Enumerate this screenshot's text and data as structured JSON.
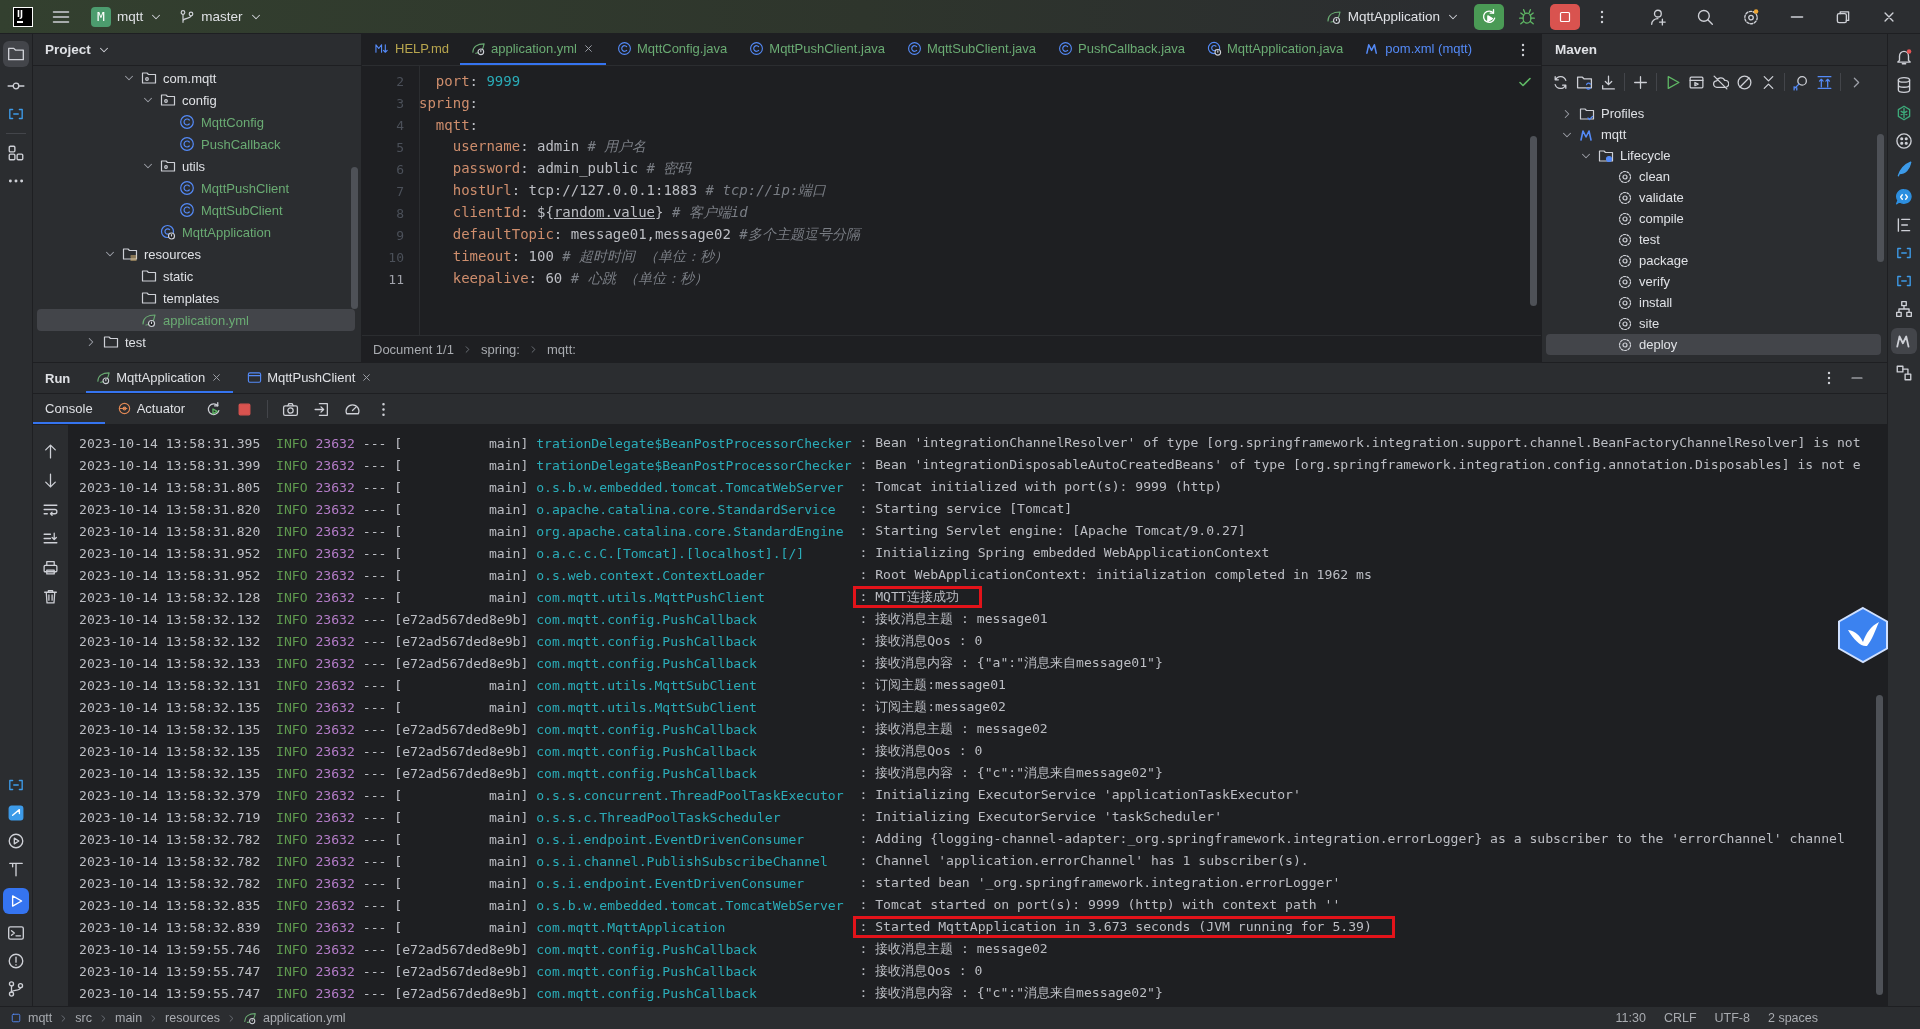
{
  "title_bar": {
    "logo": "IJ",
    "project_badge": "M",
    "project": "mqtt",
    "branch": "master",
    "run_config": "MqttApplication"
  },
  "project_panel": {
    "title": "Project",
    "tree": [
      {
        "children": [
          {
            "children": [
              {
                "label": "com.mqtt",
                "kind": "package",
                "expanded": true,
                "selected": false,
                "children": [
                  {
                    "label": "config",
                    "kind": "package",
                    "expanded": true,
                    "selected": false,
                    "children": [
                      {
                        "label": "MqttConfig",
                        "kind": "class",
                        "selected": false
                      },
                      {
                        "label": "PushCallback",
                        "kind": "class",
                        "selected": false
                      }
                    ]
                  },
                  {
                    "label": "utils",
                    "kind": "package",
                    "expanded": true,
                    "selected": false,
                    "children": [
                      {
                        "label": "MqttPushClient",
                        "kind": "class",
                        "selected": false
                      },
                      {
                        "label": "MqttSubClient",
                        "kind": "class",
                        "selected": false
                      }
                    ]
                  },
                  {
                    "label": "MqttApplication",
                    "kind": "app",
                    "selected": false
                  }
                ]
              }
            ]
          },
          {
            "label": "resources",
            "kind": "resources",
            "expanded": true,
            "selected": false,
            "children": [
              {
                "label": "static",
                "kind": "folder",
                "selected": false
              },
              {
                "label": "templates",
                "kind": "folder",
                "selected": false
              },
              {
                "label": "application.yml",
                "kind": "yaml",
                "selected": true
              }
            ]
          }
        ]
      },
      {
        "label": "test",
        "kind": "folder",
        "expanded": false,
        "selected": false
      }
    ]
  },
  "editor": {
    "tabs": [
      {
        "label": "HELP.md",
        "kind": "markdown",
        "color": "#b8a64e",
        "selected": false
      },
      {
        "label": "application.yml",
        "kind": "yaml",
        "color": "#6aab73",
        "selected": true
      },
      {
        "label": "MqttConfig.java",
        "kind": "class",
        "color": "#6aab73",
        "selected": false
      },
      {
        "label": "MqttPushClient.java",
        "kind": "class",
        "color": "#6aab73",
        "selected": false
      },
      {
        "label": "MqttSubClient.java",
        "kind": "class",
        "color": "#6aab73",
        "selected": false
      },
      {
        "label": "PushCallback.java",
        "kind": "class",
        "color": "#6aab73",
        "selected": false
      },
      {
        "label": "MqttApplication.java",
        "kind": "app",
        "color": "#6aab73",
        "selected": false
      },
      {
        "label": "pom.xml (mqtt)",
        "kind": "maven",
        "color": "#548af7",
        "selected": false
      }
    ],
    "lines": [
      {
        "number": "2",
        "current": false,
        "tokens": [
          {
            "kind": "key",
            "text": "  port"
          },
          {
            "kind": "plain",
            "text": ": "
          },
          {
            "kind": "number",
            "text": "9999"
          }
        ]
      },
      {
        "number": "3",
        "current": false,
        "tokens": [
          {
            "kind": "key",
            "text": "spring"
          },
          {
            "kind": "plain",
            "text": ":"
          }
        ]
      },
      {
        "number": "4",
        "current": false,
        "tokens": [
          {
            "kind": "key",
            "text": "  mqtt"
          },
          {
            "kind": "plain",
            "text": ":"
          }
        ]
      },
      {
        "number": "5",
        "current": false,
        "tokens": [
          {
            "kind": "key",
            "text": "    username"
          },
          {
            "kind": "plain",
            "text": ": admin "
          },
          {
            "kind": "comment",
            "text": "# 用户名"
          }
        ]
      },
      {
        "number": "6",
        "current": false,
        "tokens": [
          {
            "kind": "key",
            "text": "    password"
          },
          {
            "kind": "plain",
            "text": ": admin_public "
          },
          {
            "kind": "comment",
            "text": "# 密码"
          }
        ]
      },
      {
        "number": "7",
        "current": false,
        "tokens": [
          {
            "kind": "key",
            "text": "    hostUrl"
          },
          {
            "kind": "plain",
            "text": ": tcp://127.0.0.1:1883 "
          },
          {
            "kind": "comment",
            "text": "# tcp://ip:端口"
          }
        ]
      },
      {
        "number": "8",
        "current": false,
        "tokens": [
          {
            "kind": "key",
            "text": "    clientId"
          },
          {
            "kind": "plain",
            "text": ": ${"
          },
          {
            "kind": "ref",
            "text": "random.value"
          },
          {
            "kind": "plain",
            "text": "} "
          },
          {
            "kind": "comment",
            "text": "# 客户端id"
          }
        ]
      },
      {
        "number": "9",
        "current": false,
        "tokens": [
          {
            "kind": "key",
            "text": "    defaultTopic"
          },
          {
            "kind": "plain",
            "text": ": message01,message02 "
          },
          {
            "kind": "comment",
            "text": "#多个主题逗号分隔"
          }
        ]
      },
      {
        "number": "10",
        "current": false,
        "tokens": [
          {
            "kind": "key",
            "text": "    timeout"
          },
          {
            "kind": "plain",
            "text": ": 100 "
          },
          {
            "kind": "comment",
            "text": "# 超时时间 （单位：秒）"
          }
        ]
      },
      {
        "number": "11",
        "current": true,
        "tokens": [
          {
            "kind": "key",
            "text": "    keepalive"
          },
          {
            "kind": "plain",
            "text": ": 60 "
          },
          {
            "kind": "comment",
            "text": "# 心跳 （单位：秒）"
          }
        ]
      }
    ],
    "breadcrumbs": [
      "Document 1/1",
      "spring:",
      "mqtt:"
    ]
  },
  "maven": {
    "title": "Maven",
    "tree": [
      {
        "label": "Profiles",
        "kind": "profiles",
        "expanded": false,
        "selected": false
      },
      {
        "label": "mqtt",
        "kind": "project",
        "expanded": true,
        "selected": false,
        "children": [
          {
            "label": "Lifecycle",
            "kind": "lifecycle",
            "expanded": true,
            "selected": false,
            "children": [
              {
                "label": "clean",
                "kind": "goal",
                "selected": false
              },
              {
                "label": "validate",
                "kind": "goal",
                "selected": false
              },
              {
                "label": "compile",
                "kind": "goal",
                "selected": false
              },
              {
                "label": "test",
                "kind": "goal",
                "selected": false
              },
              {
                "label": "package",
                "kind": "goal",
                "selected": false
              },
              {
                "label": "verify",
                "kind": "goal",
                "selected": false
              },
              {
                "label": "install",
                "kind": "goal",
                "selected": false
              },
              {
                "label": "site",
                "kind": "goal",
                "selected": false
              },
              {
                "label": "deploy",
                "kind": "goal",
                "selected": true
              }
            ]
          }
        ]
      }
    ]
  },
  "run": {
    "title": "Run",
    "tabs": [
      {
        "label": "MqttApplication",
        "kind": "spring",
        "selected": true
      },
      {
        "label": "MqttPushClient",
        "kind": "window",
        "selected": false
      }
    ],
    "console_tabs": [
      {
        "label": "Console",
        "kind": "console",
        "selected": true
      },
      {
        "label": "Actuator",
        "kind": "actuator",
        "selected": false
      }
    ],
    "log": [
      {
        "timestamp": "2023-10-14 13:58:31.395",
        "level": "INFO",
        "pid": "23632",
        "separator": "---",
        "thread": "[           main]",
        "logger": "trationDelegate$BeanPostProcessorChecker",
        "message": ": Bean 'integrationChannelResolver' of type [org.springframework.integration.support.channel.BeanFactoryChannelResolver] is not",
        "highlighted": false
      },
      {
        "timestamp": "2023-10-14 13:58:31.399",
        "level": "INFO",
        "pid": "23632",
        "separator": "---",
        "thread": "[           main]",
        "logger": "trationDelegate$BeanPostProcessorChecker",
        "message": ": Bean 'integrationDisposableAutoCreatedBeans' of type [org.springframework.integration.config.annotation.Disposables] is not e",
        "highlighted": false
      },
      {
        "timestamp": "2023-10-14 13:58:31.805",
        "level": "INFO",
        "pid": "23632",
        "separator": "---",
        "thread": "[           main]",
        "logger": "o.s.b.w.embedded.tomcat.TomcatWebServer",
        "message": ": Tomcat initialized with port(s): 9999 (http)",
        "highlighted": false
      },
      {
        "timestamp": "2023-10-14 13:58:31.820",
        "level": "INFO",
        "pid": "23632",
        "separator": "---",
        "thread": "[           main]",
        "logger": "o.apache.catalina.core.StandardService",
        "message": ": Starting service [Tomcat]",
        "highlighted": false
      },
      {
        "timestamp": "2023-10-14 13:58:31.820",
        "level": "INFO",
        "pid": "23632",
        "separator": "---",
        "thread": "[           main]",
        "logger": "org.apache.catalina.core.StandardEngine",
        "message": ": Starting Servlet engine: [Apache Tomcat/9.0.27]",
        "highlighted": false
      },
      {
        "timestamp": "2023-10-14 13:58:31.952",
        "level": "INFO",
        "pid": "23632",
        "separator": "---",
        "thread": "[           main]",
        "logger": "o.a.c.c.C.[Tomcat].[localhost].[/]",
        "message": ": Initializing Spring embedded WebApplicationContext",
        "highlighted": false
      },
      {
        "timestamp": "2023-10-14 13:58:31.952",
        "level": "INFO",
        "pid": "23632",
        "separator": "---",
        "thread": "[           main]",
        "logger": "o.s.web.context.ContextLoader",
        "message": ": Root WebApplicationContext: initialization completed in 1962 ms",
        "highlighted": false
      },
      {
        "timestamp": "2023-10-14 13:58:32.128",
        "level": "INFO",
        "pid": "23632",
        "separator": "---",
        "thread": "[           main]",
        "logger": "com.mqtt.utils.MqttPushClient",
        "message": ": MQTT连接成功",
        "highlighted": true
      },
      {
        "timestamp": "2023-10-14 13:58:32.132",
        "level": "INFO",
        "pid": "23632",
        "separator": "---",
        "thread": "[e72ad567ded8e9b]",
        "logger": "com.mqtt.config.PushCallback",
        "message": ": 接收消息主题 : message01",
        "highlighted": false
      },
      {
        "timestamp": "2023-10-14 13:58:32.132",
        "level": "INFO",
        "pid": "23632",
        "separator": "---",
        "thread": "[e72ad567ded8e9b]",
        "logger": "com.mqtt.config.PushCallback",
        "message": ": 接收消息Qos : 0",
        "highlighted": false
      },
      {
        "timestamp": "2023-10-14 13:58:32.133",
        "level": "INFO",
        "pid": "23632",
        "separator": "---",
        "thread": "[e72ad567ded8e9b]",
        "logger": "com.mqtt.config.PushCallback",
        "message": ": 接收消息内容 : {\"a\":\"消息来自message01\"}",
        "highlighted": false
      },
      {
        "timestamp": "2023-10-14 13:58:32.131",
        "level": "INFO",
        "pid": "23632",
        "separator": "---",
        "thread": "[           main]",
        "logger": "com.mqtt.utils.MqttSubClient",
        "message": ": 订阅主题:message01",
        "highlighted": false
      },
      {
        "timestamp": "2023-10-14 13:58:32.135",
        "level": "INFO",
        "pid": "23632",
        "separator": "---",
        "thread": "[           main]",
        "logger": "com.mqtt.utils.MqttSubClient",
        "message": ": 订阅主题:message02",
        "highlighted": false
      },
      {
        "timestamp": "2023-10-14 13:58:32.135",
        "level": "INFO",
        "pid": "23632",
        "separator": "---",
        "thread": "[e72ad567ded8e9b]",
        "logger": "com.mqtt.config.PushCallback",
        "message": ": 接收消息主题 : message02",
        "highlighted": false
      },
      {
        "timestamp": "2023-10-14 13:58:32.135",
        "level": "INFO",
        "pid": "23632",
        "separator": "---",
        "thread": "[e72ad567ded8e9b]",
        "logger": "com.mqtt.config.PushCallback",
        "message": ": 接收消息Qos : 0",
        "highlighted": false
      },
      {
        "timestamp": "2023-10-14 13:58:32.135",
        "level": "INFO",
        "pid": "23632",
        "separator": "---",
        "thread": "[e72ad567ded8e9b]",
        "logger": "com.mqtt.config.PushCallback",
        "message": ": 接收消息内容 : {\"c\":\"消息来自message02\"}",
        "highlighted": false
      },
      {
        "timestamp": "2023-10-14 13:58:32.379",
        "level": "INFO",
        "pid": "23632",
        "separator": "---",
        "thread": "[           main]",
        "logger": "o.s.s.concurrent.ThreadPoolTaskExecutor",
        "message": ": Initializing ExecutorService 'applicationTaskExecutor'",
        "highlighted": false
      },
      {
        "timestamp": "2023-10-14 13:58:32.719",
        "level": "INFO",
        "pid": "23632",
        "separator": "---",
        "thread": "[           main]",
        "logger": "o.s.s.c.ThreadPoolTaskScheduler",
        "message": ": Initializing ExecutorService 'taskScheduler'",
        "highlighted": false
      },
      {
        "timestamp": "2023-10-14 13:58:32.782",
        "level": "INFO",
        "pid": "23632",
        "separator": "---",
        "thread": "[           main]",
        "logger": "o.s.i.endpoint.EventDrivenConsumer",
        "message": ": Adding {logging-channel-adapter:_org.springframework.integration.errorLogger} as a subscriber to the 'errorChannel' channel",
        "highlighted": false
      },
      {
        "timestamp": "2023-10-14 13:58:32.782",
        "level": "INFO",
        "pid": "23632",
        "separator": "---",
        "thread": "[           main]",
        "logger": "o.s.i.channel.PublishSubscribeChannel",
        "message": ": Channel 'application.errorChannel' has 1 subscriber(s).",
        "highlighted": false
      },
      {
        "timestamp": "2023-10-14 13:58:32.782",
        "level": "INFO",
        "pid": "23632",
        "separator": "---",
        "thread": "[           main]",
        "logger": "o.s.i.endpoint.EventDrivenConsumer",
        "message": ": started bean '_org.springframework.integration.errorLogger'",
        "highlighted": false
      },
      {
        "timestamp": "2023-10-14 13:58:32.835",
        "level": "INFO",
        "pid": "23632",
        "separator": "---",
        "thread": "[           main]",
        "logger": "o.s.b.w.embedded.tomcat.TomcatWebServer",
        "message": ": Tomcat started on port(s): 9999 (http) with context path ''",
        "highlighted": false
      },
      {
        "timestamp": "2023-10-14 13:58:32.839",
        "level": "INFO",
        "pid": "23632",
        "separator": "---",
        "thread": "[           main]",
        "logger": "com.mqtt.MqttApplication",
        "message": ": Started MqttApplication in 3.673 seconds (JVM running for 5.39)",
        "highlighted": true
      },
      {
        "timestamp": "2023-10-14 13:59:55.746",
        "level": "INFO",
        "pid": "23632",
        "separator": "---",
        "thread": "[e72ad567ded8e9b]",
        "logger": "com.mqtt.config.PushCallback",
        "message": ": 接收消息主题 : message02",
        "highlighted": false
      },
      {
        "timestamp": "2023-10-14 13:59:55.747",
        "level": "INFO",
        "pid": "23632",
        "separator": "---",
        "thread": "[e72ad567ded8e9b]",
        "logger": "com.mqtt.config.PushCallback",
        "message": ": 接收消息Qos : 0",
        "highlighted": false
      },
      {
        "timestamp": "2023-10-14 13:59:55.747",
        "level": "INFO",
        "pid": "23632",
        "separator": "---",
        "thread": "[e72ad567ded8e9b]",
        "logger": "com.mqtt.config.PushCallback",
        "message": ": 接收消息内容 : {\"c\":\"消息来自message02\"}",
        "highlighted": false
      }
    ]
  },
  "status_bar": {
    "path": [
      "mqtt",
      "src",
      "main",
      "resources",
      "application.yml"
    ],
    "items": [
      "11:30",
      "CRLF",
      "UTF-8",
      "2 spaces"
    ]
  }
}
